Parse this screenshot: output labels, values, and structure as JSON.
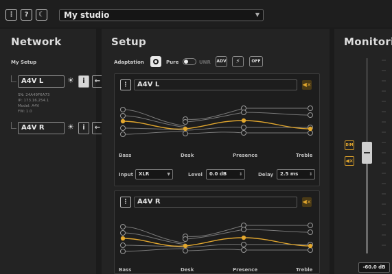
{
  "topbar": {
    "menu_label": "⋮",
    "help_label": "?",
    "theme_label": "☾",
    "studio_value": "My studio"
  },
  "network": {
    "title": "Network",
    "setup_label": "My Setup",
    "devices": [
      {
        "name": "A4V L",
        "info": {
          "sn": "SN: 24A49F6A73",
          "ip": "IP: 173.16.254.1",
          "model": "Model: A4V",
          "fw": "FW: 1.0"
        }
      },
      {
        "name": "A4V R"
      }
    ]
  },
  "setup": {
    "title": "Setup",
    "adaptation_label": "Adaptation",
    "pure_label": "Pure",
    "unr_label": "UNR",
    "adv_label": "ADV",
    "flash_label": "⚡",
    "off_label": "OFF",
    "cards": [
      {
        "name": "A4V L",
        "bands": [
          "Bass",
          "Desk",
          "Presence",
          "Treble"
        ],
        "input_label": "Input",
        "input_value": "XLR",
        "level_label": "Level",
        "level_value": "0.0 dB",
        "delay_label": "Delay",
        "delay_value": "2.5 ms"
      },
      {
        "name": "A4V R",
        "bands": [
          "Bass",
          "Desk",
          "Presence",
          "Treble"
        ]
      }
    ]
  },
  "monitoring": {
    "title": "Monitori",
    "dim_label": "DIM",
    "mute_label": "◀×",
    "level_value": "-60.0 dB"
  },
  "colors": {
    "accent": "#e2a72e",
    "bg": "#1b1b1b",
    "panel": "#232323"
  }
}
